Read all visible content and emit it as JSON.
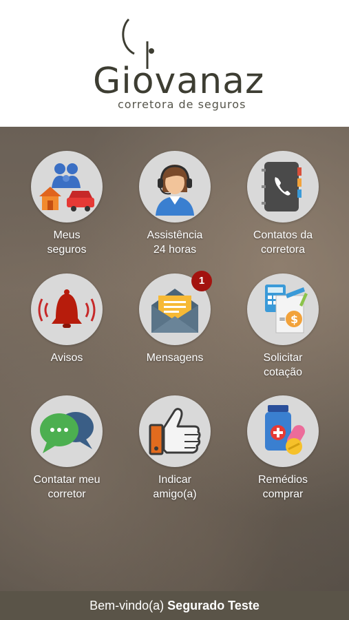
{
  "header": {
    "brand_name": "Giovanaz",
    "brand_tagline": "corretora de seguros"
  },
  "menu": [
    {
      "label_line1": "Meus",
      "label_line2": "seguros",
      "icon": "family-home-car-icon"
    },
    {
      "label_line1": "Assistência",
      "label_line2": "24 horas",
      "icon": "headset-agent-icon"
    },
    {
      "label_line1": "Contatos da",
      "label_line2": "corretora",
      "icon": "phonebook-icon"
    },
    {
      "label_line1": "Avisos",
      "label_line2": "",
      "icon": "alarm-bell-icon"
    },
    {
      "label_line1": "Mensagens",
      "label_line2": "",
      "icon": "envelope-icon",
      "badge": "1"
    },
    {
      "label_line1": "Solicitar",
      "label_line2": "cotação",
      "icon": "calculator-money-icon"
    },
    {
      "label_line1": "Contatar meu",
      "label_line2": "corretor",
      "icon": "chat-bubbles-icon"
    },
    {
      "label_line1": "Indicar",
      "label_line2": "amigo(a)",
      "icon": "thumbs-up-icon"
    },
    {
      "label_line1": "Remédios",
      "label_line2": "comprar",
      "icon": "medicine-icon"
    }
  ],
  "footer": {
    "greeting": "Bem-vindo(a)",
    "user_name": "Segurado Teste"
  },
  "colors": {
    "footer_bg": "#5a5448",
    "badge": "#a3130f",
    "circle_bg": "#d9d9d9"
  }
}
